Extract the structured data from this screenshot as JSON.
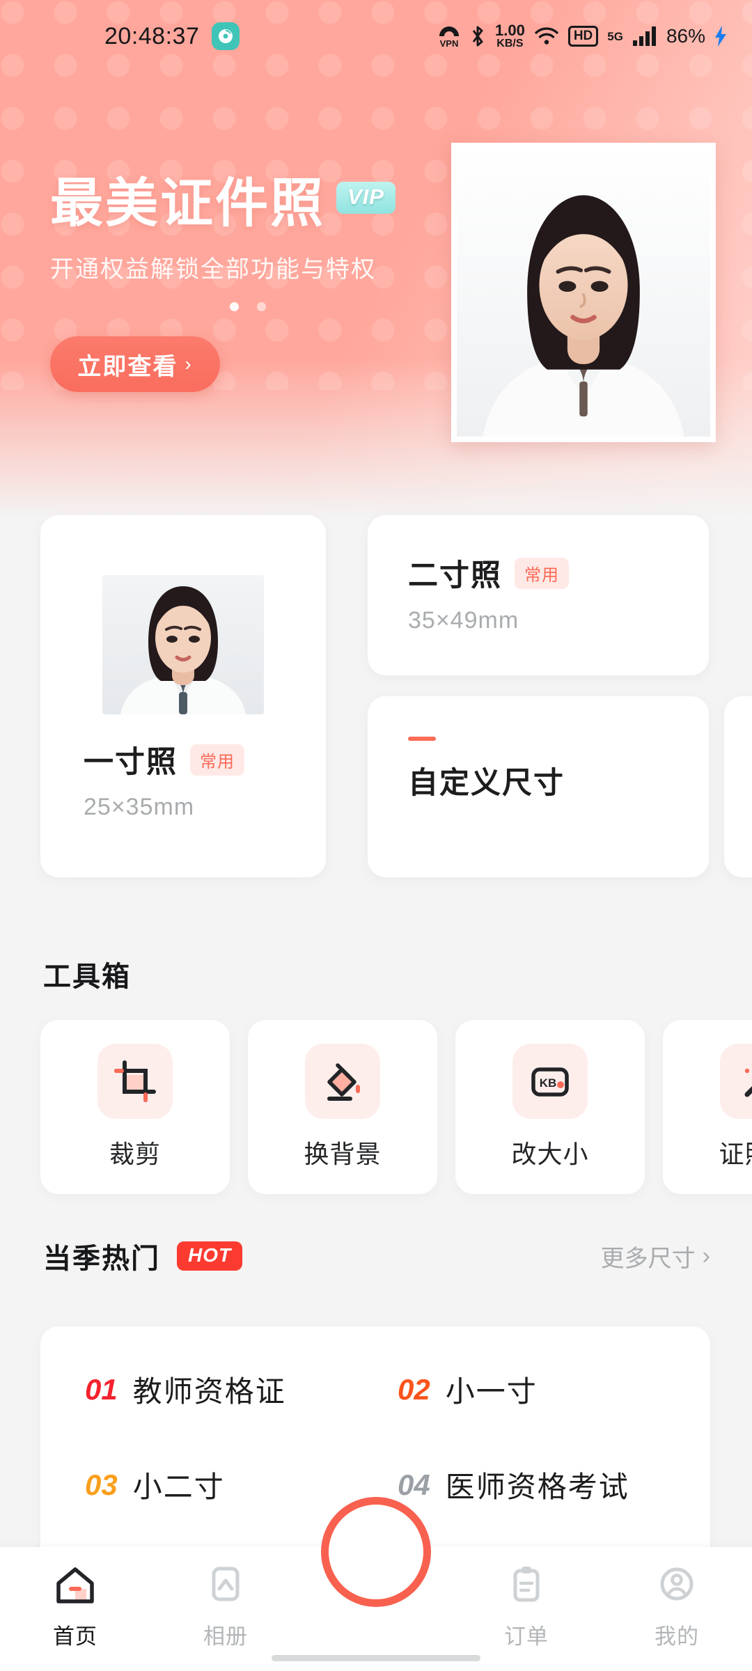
{
  "status_bar": {
    "time": "20:48:37",
    "app_icon": "music-app-icon",
    "vpn_label": "VPN",
    "net_speed_value": "1.00",
    "net_speed_unit": "KB/S",
    "hd_label": "HD",
    "network_label": "5G",
    "battery": "86%",
    "charging_icon": "lightning-bolt-icon"
  },
  "banner": {
    "title": "最美证件照",
    "vip_label": "VIP",
    "subtitle": "开通权益解锁全部功能与特权",
    "cta_label": "立即查看",
    "cta_chevron": "›",
    "dots_total": 2,
    "dots_active": 1,
    "accent": "#fb6b57",
    "bg_start": "#ffa79c",
    "bg_end": "#ffd4cd"
  },
  "sizes": {
    "one_inch": {
      "title": "一寸照",
      "tag": "常用",
      "dimensions": "25×35mm"
    },
    "two_inch": {
      "title": "二寸照",
      "tag": "常用",
      "dimensions": "35×49mm"
    },
    "custom": {
      "title": "自定义尺寸"
    }
  },
  "toolbox": {
    "title": "工具箱",
    "items": [
      {
        "label": "裁剪",
        "icon": "crop-icon"
      },
      {
        "label": "换背景",
        "icon": "paint-bucket-icon"
      },
      {
        "label": "改大小",
        "icon": "kb-resize-icon"
      },
      {
        "label": "证照美",
        "icon": "magic-wand-icon"
      }
    ]
  },
  "hot": {
    "title": "当季热门",
    "badge": "HOT",
    "more_label": "更多尺寸",
    "more_chevron": "›",
    "items": [
      {
        "rank": "01",
        "name": "教师资格证",
        "color": "#f5222d"
      },
      {
        "rank": "02",
        "name": "小一寸",
        "color": "#fa541c"
      },
      {
        "rank": "03",
        "name": "小二寸",
        "color": "#fa9f1c"
      },
      {
        "rank": "04",
        "name": "医师资格考试",
        "color": "#9aa0a6"
      }
    ]
  },
  "tabbar": {
    "items": [
      {
        "label": "首页",
        "icon": "home-icon",
        "active": true
      },
      {
        "label": "相册",
        "icon": "album-icon",
        "active": false
      },
      {
        "label": "订单",
        "icon": "order-clipboard-icon",
        "active": false
      },
      {
        "label": "我的",
        "icon": "profile-icon",
        "active": false
      }
    ],
    "camera_button": "camera-shutter-button"
  }
}
